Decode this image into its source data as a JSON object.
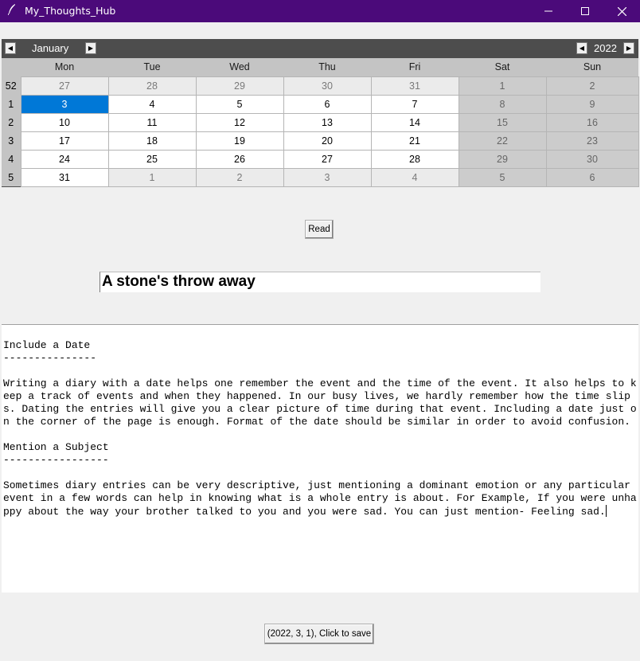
{
  "window": {
    "title": "My_Thoughts_Hub",
    "icon": "feather-pen-icon",
    "minimize": "–",
    "maximize": "□",
    "close": "✕"
  },
  "calendar": {
    "month": "January",
    "year": "2022",
    "prev_icon": "◀",
    "next_icon": "▶",
    "weekdays": [
      "Mon",
      "Tue",
      "Wed",
      "Thu",
      "Fri",
      "Sat",
      "Sun"
    ],
    "weeks": [
      {
        "week": "52",
        "days": [
          "27",
          "28",
          "29",
          "30",
          "31",
          "1",
          "2"
        ]
      },
      {
        "week": "1",
        "days": [
          "3",
          "4",
          "5",
          "6",
          "7",
          "8",
          "9"
        ]
      },
      {
        "week": "2",
        "days": [
          "10",
          "11",
          "12",
          "13",
          "14",
          "15",
          "16"
        ]
      },
      {
        "week": "3",
        "days": [
          "17",
          "18",
          "19",
          "20",
          "21",
          "22",
          "23"
        ]
      },
      {
        "week": "4",
        "days": [
          "24",
          "25",
          "26",
          "27",
          "28",
          "29",
          "30"
        ]
      },
      {
        "week": "5",
        "days": [
          "31",
          "1",
          "2",
          "3",
          "4",
          "5",
          "6"
        ]
      }
    ],
    "selected_day": "3",
    "colors": {
      "header_bg": "#4d4d4d",
      "selected_bg": "#0078d7",
      "titlebar": "#4b0a7a"
    }
  },
  "read_button": "Read",
  "entry_title": "A stone's throw away",
  "body_text": "Include a Date\n---------------\n\nWriting a diary with a date helps one remember the event and the time of the event. It also helps to keep a track of events and when they happened. In our busy lives, we hardly remember how the time slips. Dating the entries will give you a clear picture of time during that event. Including a date just on the corner of the page is enough. Format of the date should be similar in order to avoid confusion.\n\nMention a Subject\n-----------------\n\nSometimes diary entries can be very descriptive, just mentioning a dominant emotion or any particular event in a few words can help in knowing what is a whole entry is about. For Example, If you were unhappy about the way your brother talked to you and you were sad. You can just mention- Feeling sad.",
  "save_button": "(2022, 3, 1), Click to save"
}
